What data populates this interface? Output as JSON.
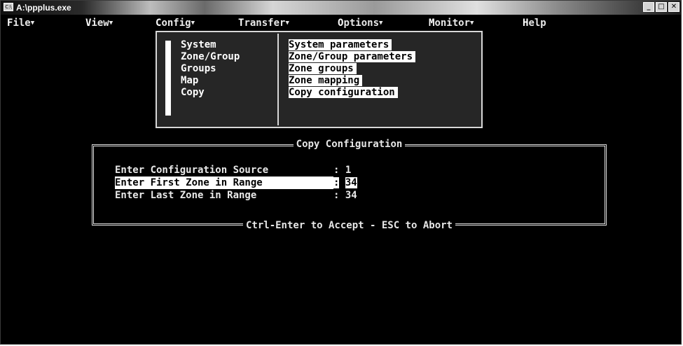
{
  "window": {
    "title": "A:\\ppplus.exe"
  },
  "menubar": [
    {
      "first": "F",
      "rest": "ile",
      "arrow": "▼"
    },
    {
      "first": "V",
      "rest": "iew",
      "arrow": "▼"
    },
    {
      "first": "C",
      "rest": "onfig",
      "arrow": "▼"
    },
    {
      "first": "T",
      "rest": "ransfer",
      "arrow": "▼"
    },
    {
      "first": "O",
      "rest": "ptions",
      "arrow": "▼"
    },
    {
      "first": "M",
      "rest": "onitor",
      "arrow": "▼"
    },
    {
      "first": "H",
      "rest": "elp",
      "arrow": ""
    }
  ],
  "config_menu": {
    "items": [
      "System",
      "Zone/Group",
      "Groups",
      "Map",
      "Copy"
    ],
    "descriptions": [
      "System parameters",
      "Zone/Group parameters",
      "Zone groups",
      "Zone mapping",
      "Copy configuration"
    ]
  },
  "dialog": {
    "title": "Copy Configuration",
    "footer": "Ctrl-Enter to Accept - ESC to Abort",
    "fields": [
      {
        "label": "Enter Configuration Source",
        "value": "1"
      },
      {
        "label": "Enter First Zone in Range",
        "value": "34"
      },
      {
        "label": "Enter Last Zone in Range",
        "value": "34"
      }
    ],
    "separator": ":"
  },
  "title_buttons": [
    "_",
    "□",
    "✕"
  ]
}
